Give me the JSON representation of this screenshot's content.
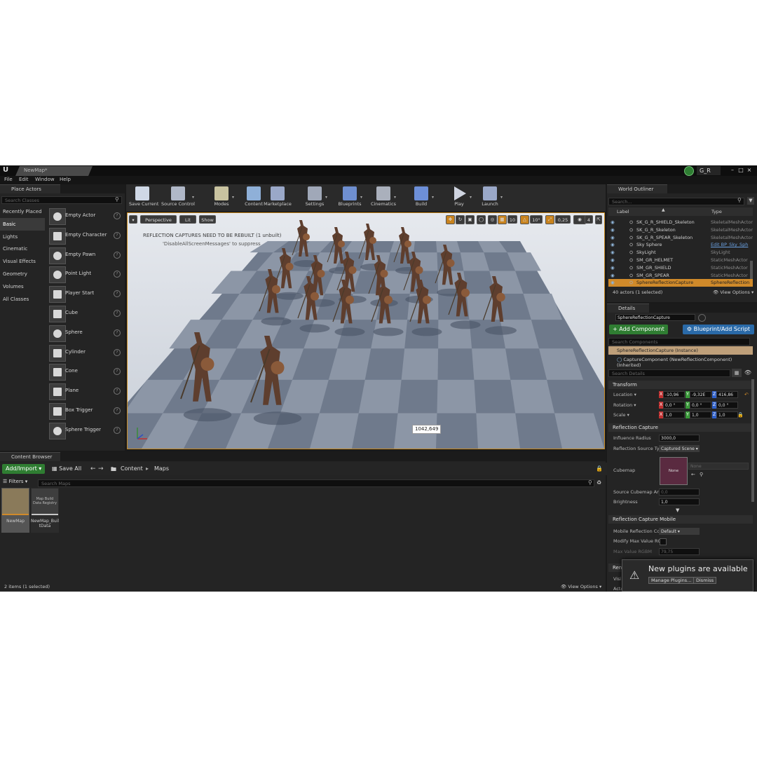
{
  "window": {
    "tab_title": "NewMap*",
    "user": "G_R",
    "menu": [
      "File",
      "Edit",
      "Window",
      "Help"
    ]
  },
  "place_actors": {
    "tab_title": "Place Actors",
    "search_placeholder": "Search Classes",
    "categories": [
      {
        "label": "Recently Placed",
        "selected": false
      },
      {
        "label": "Basic",
        "selected": true
      },
      {
        "label": "Lights",
        "selected": false
      },
      {
        "label": "Cinematic",
        "selected": false
      },
      {
        "label": "Visual Effects",
        "selected": false
      },
      {
        "label": "Geometry",
        "selected": false
      },
      {
        "label": "Volumes",
        "selected": false
      },
      {
        "label": "All Classes",
        "selected": false
      }
    ],
    "actors": [
      {
        "label": "Empty Actor",
        "icon": "sphere-grey-icon"
      },
      {
        "label": "Empty Character",
        "icon": "character-icon"
      },
      {
        "label": "Empty Pawn",
        "icon": "pawn-icon"
      },
      {
        "label": "Point Light",
        "icon": "light-bulb-icon"
      },
      {
        "label": "Player Start",
        "icon": "player-start-icon"
      },
      {
        "label": "Cube",
        "icon": "cube-icon"
      },
      {
        "label": "Sphere",
        "icon": "sphere-icon"
      },
      {
        "label": "Cylinder",
        "icon": "cylinder-icon"
      },
      {
        "label": "Cone",
        "icon": "cone-icon"
      },
      {
        "label": "Plane",
        "icon": "plane-icon"
      },
      {
        "label": "Box Trigger",
        "icon": "box-trigger-icon"
      },
      {
        "label": "Sphere Trigger",
        "icon": "sphere-trigger-icon"
      }
    ]
  },
  "toolbar": {
    "items": [
      {
        "label": "Save Current",
        "icon": "save-icon",
        "dropdown": false
      },
      {
        "label": "Source Control",
        "icon": "source-control-icon",
        "dropdown": true
      },
      {
        "label": "Modes",
        "icon": "modes-icon",
        "dropdown": true
      },
      {
        "label": "Content",
        "icon": "content-icon",
        "dropdown": false
      },
      {
        "label": "Marketplace",
        "icon": "marketplace-icon",
        "dropdown": false
      },
      {
        "label": "Settings",
        "icon": "settings-icon",
        "dropdown": true
      },
      {
        "label": "Blueprints",
        "icon": "blueprints-icon",
        "dropdown": true
      },
      {
        "label": "Cinematics",
        "icon": "cinematics-icon",
        "dropdown": true
      },
      {
        "label": "Build",
        "icon": "build-icon",
        "dropdown": true
      },
      {
        "label": "Play",
        "icon": "play-icon",
        "dropdown": true
      },
      {
        "label": "Launch",
        "icon": "launch-icon",
        "dropdown": true
      }
    ]
  },
  "viewport": {
    "perspective_label": "Perspective",
    "lit_label": "Lit",
    "show_label": "Show",
    "grid_snap": "10",
    "rotation_snap": "10°",
    "scale_snap": "0,25",
    "camera_speed": "4",
    "message_line1": "REFLECTION CAPTURES NEED TO BE REBUILT (1 unbuilt)",
    "message_line2": "'DisableAllScreenMessages' to suppress",
    "coordinate_readout": "1042,649"
  },
  "world_outliner": {
    "tab_title": "World Outliner",
    "search_placeholder": "Search...",
    "col_label": "Label",
    "col_type": "Type",
    "rows": [
      {
        "label": "SK_G_R_SHIELD_Skeleton",
        "type": "SkeletalMeshActor",
        "selected": false,
        "link": false
      },
      {
        "label": "SK_G_R_Skeleton",
        "type": "SkeletalMeshActor",
        "selected": false,
        "link": false
      },
      {
        "label": "SK_G_R_SPEAR_Skeleton",
        "type": "SkeletalMeshActor",
        "selected": false,
        "link": false
      },
      {
        "label": "Sky Sphere",
        "type": "Edit BP_Sky_Sph",
        "selected": false,
        "link": true
      },
      {
        "label": "SkyLight",
        "type": "SkyLight",
        "selected": false,
        "link": false
      },
      {
        "label": "SM_GR_HELMET",
        "type": "StaticMeshActor",
        "selected": false,
        "link": false
      },
      {
        "label": "SM_GR_SHIELD",
        "type": "StaticMeshActor",
        "selected": false,
        "link": false
      },
      {
        "label": "SM_GR_SPEAR",
        "type": "StaticMeshActor",
        "selected": false,
        "link": false
      },
      {
        "label": "SphereReflectionCapture",
        "type": "SphereReflection",
        "selected": true,
        "link": false
      }
    ],
    "status": "40 actors (1 selected)",
    "view_options": "View Options"
  },
  "details": {
    "tab_title": "Details",
    "name_value": "SphereReflectionCapture",
    "add_component": "+ Add Component",
    "blueprint_script": "Blueprint/Add Script",
    "components_search": "Search Components",
    "component_root": "SphereReflectionCapture (Instance)",
    "component_child": "CaptureComponent (NewReflectionComponent) (Inherited)",
    "details_search": "Search Details",
    "transform": {
      "title": "Transform",
      "location_label": "Location",
      "rotation_label": "Rotation",
      "scale_label": "Scale",
      "location": [
        "-10,96",
        "-9,32E",
        "416,86"
      ],
      "rotation": [
        "0,0 °",
        "0,0 °",
        "0,0 °"
      ],
      "scale": [
        "1,0",
        "1,0",
        "1,0"
      ]
    },
    "reflection_capture": {
      "title": "Reflection Capture",
      "influence_radius_label": "Influence Radius",
      "influence_radius": "3000,0",
      "source_type_label": "Reflection Source Typ",
      "source_type": "Captured Scene",
      "cubemap_label": "Cubemap",
      "cubemap_thumb": "None",
      "cubemap_value": "None",
      "source_angle_label": "Source Cubemap Angl",
      "source_angle": "0,0",
      "brightness_label": "Brightness",
      "brightness": "1,0"
    },
    "reflection_capture_mobile": {
      "title": "Reflection Capture Mobile",
      "mobile_label": "Mobile Reflection Com",
      "mobile_value": "Default",
      "modify_label": "Modify Max Value RGI",
      "max_value_label": "Max Value RGBM",
      "max_value": "79,75"
    },
    "rendering_partial": "Ren",
    "visible_partial": "Visi",
    "hidden_partial": "Actor Hidden in Game"
  },
  "content_browser": {
    "tab_title": "Content Browser",
    "add_import": "Add/Import",
    "save_all": "Save All",
    "path": [
      "Content",
      "Maps"
    ],
    "filters": "Filters",
    "search_placeholder": "Search Maps",
    "assets": [
      {
        "label": "NewMap",
        "thumb_text": "",
        "selected": true
      },
      {
        "label": "NewMap_BuiltData",
        "thumb_text": "Map Build Data Registry",
        "selected": false
      }
    ],
    "status": "2 items (1 selected)",
    "view_options": "View Options"
  },
  "notification": {
    "title": "New plugins are available",
    "manage": "Manage Plugins...",
    "dismiss": "Dismiss"
  },
  "colors": {
    "accent_orange": "#d08a2a",
    "green_button": "#2f7d32",
    "blue_button": "#2a6aa8",
    "panel_bg": "#242424"
  }
}
